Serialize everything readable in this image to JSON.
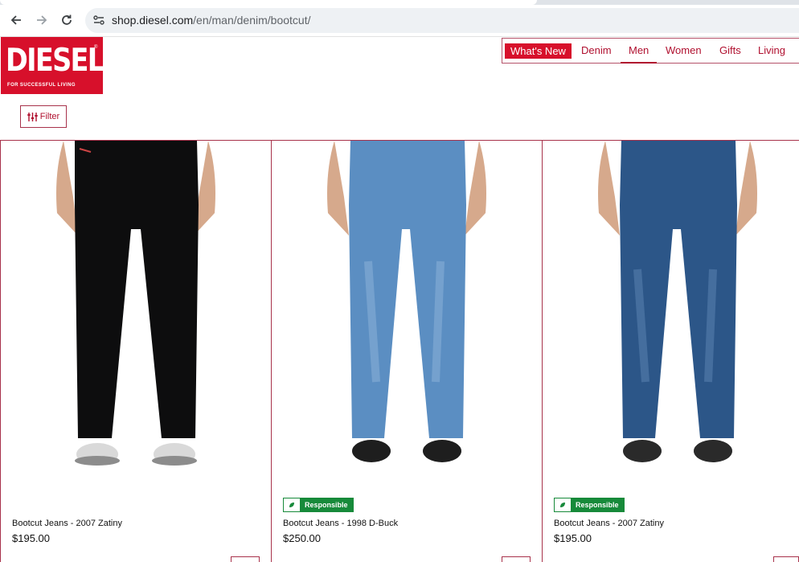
{
  "browser": {
    "url_host": "shop.diesel.com",
    "url_path": "/en/man/denim/bootcut/"
  },
  "brand": {
    "logo_text": "DIESEL",
    "tagline": "FOR SUCCESSFUL LIVING",
    "reg_mark": "®",
    "color": "#d7102b"
  },
  "nav": {
    "items": [
      {
        "label": "What's New"
      },
      {
        "label": "Denim"
      },
      {
        "label": "Men"
      },
      {
        "label": "Women"
      },
      {
        "label": "Gifts"
      },
      {
        "label": "Living"
      }
    ],
    "active": "Men",
    "highlighted": "What's New"
  },
  "filter": {
    "label": "Filter"
  },
  "products": [
    {
      "name": "Bootcut Jeans - 2007 Zatiny",
      "price": "$195.00",
      "badge": "",
      "denim_color": "#0d0d0e",
      "shoe": "white-silver"
    },
    {
      "name": "Bootcut Jeans - 1998 D-Buck",
      "price": "$250.00",
      "badge": "Responsible",
      "denim_color": "#5b8ec2",
      "shoe": "black"
    },
    {
      "name": "Bootcut Jeans - 2007 Zatiny",
      "price": "$195.00",
      "badge": "Responsible",
      "denim_color": "#2c5688",
      "shoe": "black"
    }
  ],
  "colors": {
    "accent": "#b0102f",
    "responsible_green": "#178a3a"
  }
}
